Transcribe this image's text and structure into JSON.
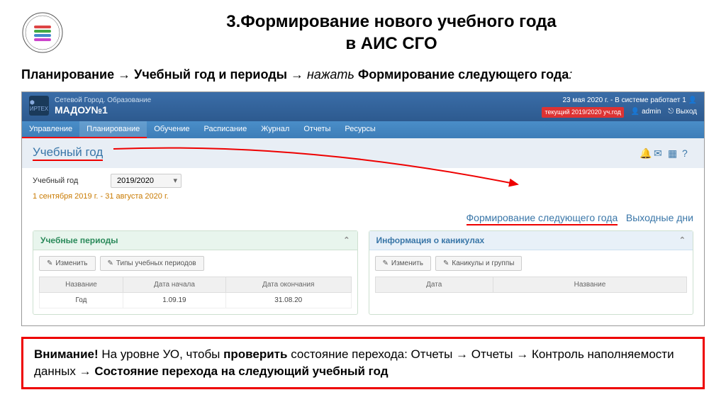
{
  "slide": {
    "title_line1": "3.Формирование нового учебного года",
    "title_line2": "в АИС СГО",
    "instruction_prefix": "Планирование",
    "instruction_mid": "Учебный год и периоды",
    "instruction_action": "нажать",
    "instruction_target": "Формирование следующего года",
    "arrow": "→"
  },
  "topbar": {
    "system_label": "Сетевой Город. Образование",
    "org_name": "МАДОУ№1",
    "date_status": "23 мая 2020 г. - В системе работает 1",
    "year_badge": "текущий 2019/2020 уч.год",
    "user_icon_label": "admin",
    "exit_label": "Выход"
  },
  "menu": {
    "items": [
      "Управление",
      "Планирование",
      "Обучение",
      "Расписание",
      "Журнал",
      "Отчеты",
      "Ресурсы"
    ]
  },
  "subheader": {
    "title": "Учебный год"
  },
  "fields": {
    "year_label": "Учебный год",
    "year_value": "2019/2020",
    "date_range": "1 сентября 2019 г. - 31 августа 2020 г."
  },
  "actions": {
    "form_next": "Формирование следующего года",
    "weekends": "Выходные дни"
  },
  "panel1": {
    "title": "Учебные периоды",
    "btn_edit": "Изменить",
    "btn_types": "Типы учебных периодов",
    "headers": [
      "Название",
      "Дата начала",
      "Дата окончания"
    ],
    "row": [
      "Год",
      "1.09.19",
      "31.08.20"
    ]
  },
  "panel2": {
    "title": "Информация о каникулах",
    "btn_edit": "Изменить",
    "btn_groups": "Каникулы и группы",
    "headers": [
      "Дата",
      "Название"
    ]
  },
  "warning": {
    "label": "Внимание!",
    "text1": " На уровне УО, чтобы ",
    "bold1": "проверить",
    "text2": " состояние перехода: Отчеты → Отчеты → Контроль наполняемости данных → ",
    "bold2": "Состояние перехода на следующий учебный год"
  }
}
